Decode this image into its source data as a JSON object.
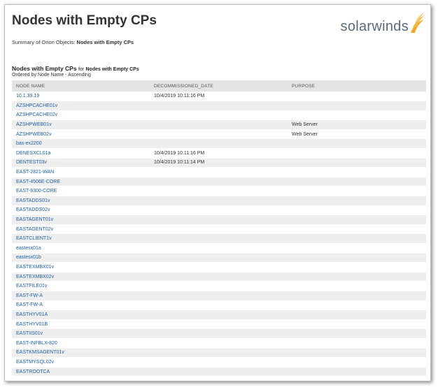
{
  "header": {
    "title": "Nodes with Empty CPs",
    "summary_prefix": "Summary of Orion Objects:",
    "summary_value": "Nodes with Empty CPs",
    "logo_text": "solarwinds",
    "logo_color": "#f5a623"
  },
  "section": {
    "title": "Nodes with Empty CPs",
    "for_text": "for",
    "for_value": "Nodes with Empty CPs",
    "ordered_by": "Ordered by:Node Name - Ascending"
  },
  "table": {
    "columns": [
      "NODE NAME",
      "DECOMMISSIONED_DATE",
      "PURPOSE"
    ],
    "rows": [
      [
        "10.1.39.19",
        "10/4/2019 10:11:16 PM",
        ""
      ],
      [
        "AZSHPCACHE01v",
        "",
        ""
      ],
      [
        "AZSHPCACHE02v",
        "",
        ""
      ],
      [
        "AZSHPWEB01v",
        "",
        "Web Server"
      ],
      [
        "AZSHPWEB02v",
        "",
        "Web Server"
      ],
      [
        "bas-ex2200",
        "",
        ""
      ],
      [
        "DENESXCL01a",
        "10/4/2019 10:11:16 PM",
        ""
      ],
      [
        "DENTEST03v",
        "10/4/2019 10:11:14 PM",
        ""
      ],
      [
        "EAST-2821-WAN",
        "",
        ""
      ],
      [
        "EAST-4506E-CORE",
        "",
        ""
      ],
      [
        "EAST-9300-CORE",
        "",
        ""
      ],
      [
        "EASTADDS01v",
        "",
        ""
      ],
      [
        "EASTADDS02v",
        "",
        ""
      ],
      [
        "EASTAGENT01v",
        "",
        ""
      ],
      [
        "EASTAGENT02v",
        "",
        ""
      ],
      [
        "EASTCLIENT1v",
        "",
        ""
      ],
      [
        "eastesx01a",
        "",
        ""
      ],
      [
        "eastesx01b",
        "",
        ""
      ],
      [
        "EASTEXMBX01v",
        "",
        ""
      ],
      [
        "EASTEXMBX02v",
        "",
        ""
      ],
      [
        "EASTFILE01v",
        "",
        ""
      ],
      [
        "EAST-FW-A",
        "",
        ""
      ],
      [
        "EAST-FW-A",
        "",
        ""
      ],
      [
        "EASTHYV01A",
        "",
        ""
      ],
      [
        "EASTHYV01B",
        "",
        ""
      ],
      [
        "EASTIIS01v",
        "",
        ""
      ],
      [
        "EAST-INFBLX-820",
        "",
        ""
      ],
      [
        "EASTKMSAGENT01v",
        "",
        ""
      ],
      [
        "EASTMYSQL02v",
        "",
        ""
      ],
      [
        "EASTROOTCA",
        "",
        ""
      ]
    ]
  }
}
